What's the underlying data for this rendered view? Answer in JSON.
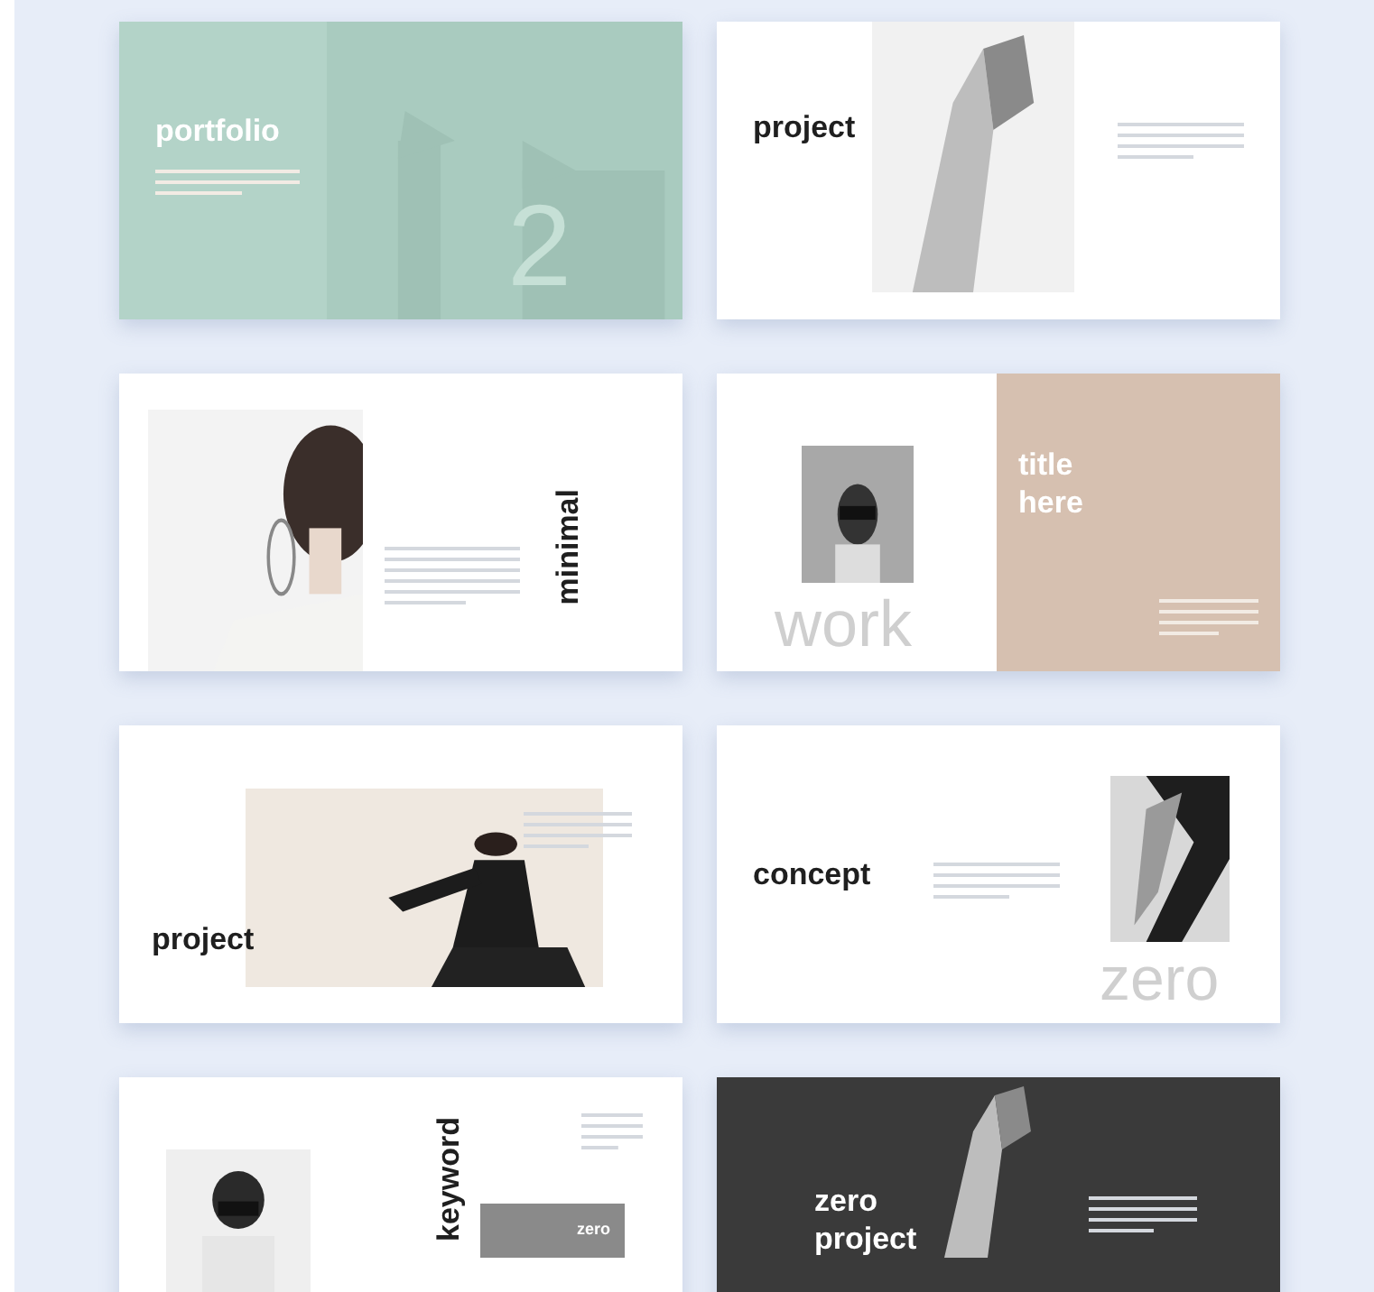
{
  "slides": [
    {
      "kind": "portfolio",
      "title": "portfolio",
      "number": "2"
    },
    {
      "kind": "legs",
      "title": "project"
    },
    {
      "kind": "minimal",
      "title": "minimal"
    },
    {
      "kind": "title-here",
      "title": "title here",
      "big": "work"
    },
    {
      "kind": "dancer",
      "title": "project"
    },
    {
      "kind": "concept",
      "title": "concept",
      "big": "zero"
    },
    {
      "kind": "keyword",
      "title": "keyword",
      "tag": "zero"
    },
    {
      "kind": "dark",
      "title": "zero project"
    }
  ]
}
